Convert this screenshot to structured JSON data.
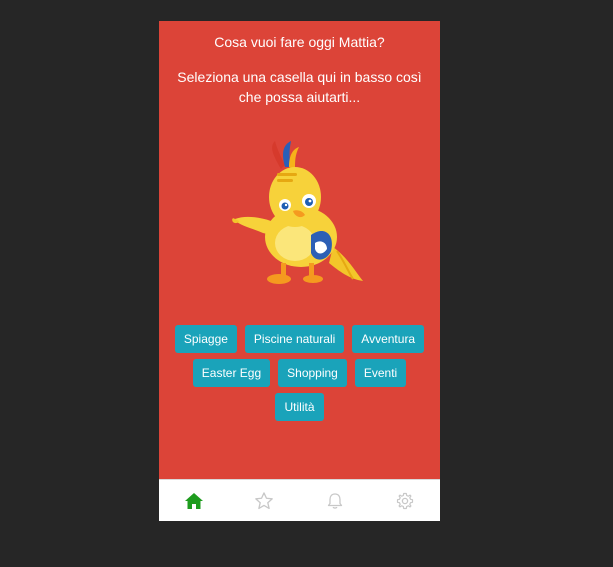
{
  "header": {
    "greeting": "Cosa vuoi fare oggi Mattia?",
    "instruction": "Seleziona una casella qui in basso così che possa aiutarti..."
  },
  "categories": {
    "row1": [
      "Spiagge",
      "Piscine naturali",
      "Avventura"
    ],
    "row2": [
      "Easter Egg",
      "Shopping",
      "Eventi"
    ],
    "row3": [
      "Utilità"
    ]
  },
  "tabbar": {
    "tabs": [
      {
        "icon": "home-icon",
        "active": true
      },
      {
        "icon": "star-icon",
        "active": false
      },
      {
        "icon": "bell-icon",
        "active": false
      },
      {
        "icon": "gear-icon",
        "active": false
      }
    ],
    "active_color": "#1e9c1e",
    "inactive_color": "#c8c8c8"
  },
  "colors": {
    "background": "#dc4438",
    "chip": "#1aa3ba",
    "mascot": "#f7d23a"
  }
}
